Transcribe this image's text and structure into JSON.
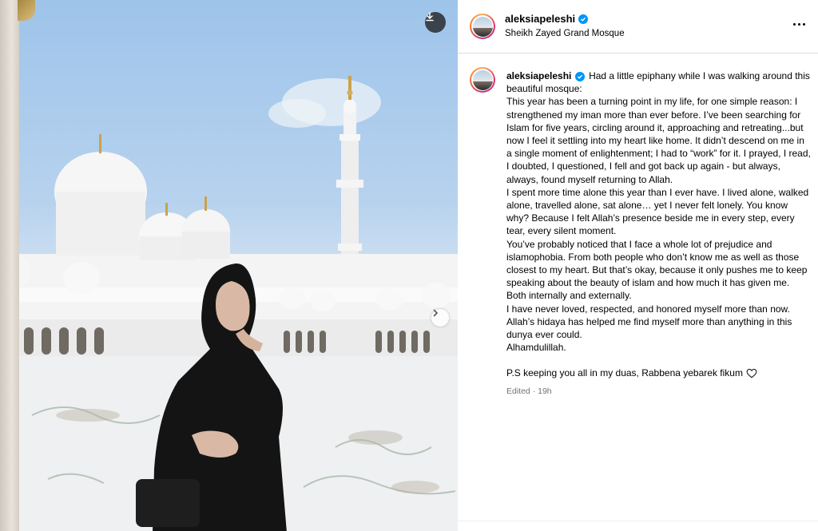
{
  "post": {
    "username": "aleksiapeleshi",
    "location": "Sheikh Zayed Grand Mosque",
    "caption_intro": "Had a little epiphany while I was walking around this beautiful mosque:",
    "paragraphs": [
      "This year has been a turning point in my life, for one simple reason: I strengthened my iman more than ever before. I’ve been searching for Islam for five years, circling around it, approaching and retreating...but now I feel it settling into my heart like home. It didn’t descend on me in a single moment of enlightenment; I had to “work” for it. I prayed, I read, I doubted, I questioned, I fell and got back up again - but always, always, found myself returning to Allah.",
      "I spent more time alone this year than I ever have. I lived alone, walked alone, travelled alone, sat alone… yet I never felt lonely. You know why? Because I felt Allah’s presence beside me in every step, every tear, every silent moment.",
      "You’ve probably noticed that I face a whole lot of prejudice and islamophobia. From both people who don’t know me as well as those closest to my heart. But that’s okay, because it only pushes me to keep speaking about the beauty of islam and how much it has given me. Both internally and externally.",
      "I have never loved, respected, and honored myself more than now. Allah’s hidaya has helped me find myself more than anything in this dunya ever could.",
      "Alhamdulillah."
    ],
    "ps": "P.S keeping you all in my duas, Rabbena yebarek fikum",
    "edited_label": "Edited",
    "separator": "·",
    "time_ago": "19h"
  },
  "icons": {
    "download": "download-icon",
    "next": "chevron-right-icon",
    "more": "more-options-icon",
    "verified": "verified-badge-icon",
    "heart": "heart-icon"
  },
  "colors": {
    "verified": "#0095f6",
    "muted_text": "#737373",
    "divider": "#dbdbdb"
  }
}
